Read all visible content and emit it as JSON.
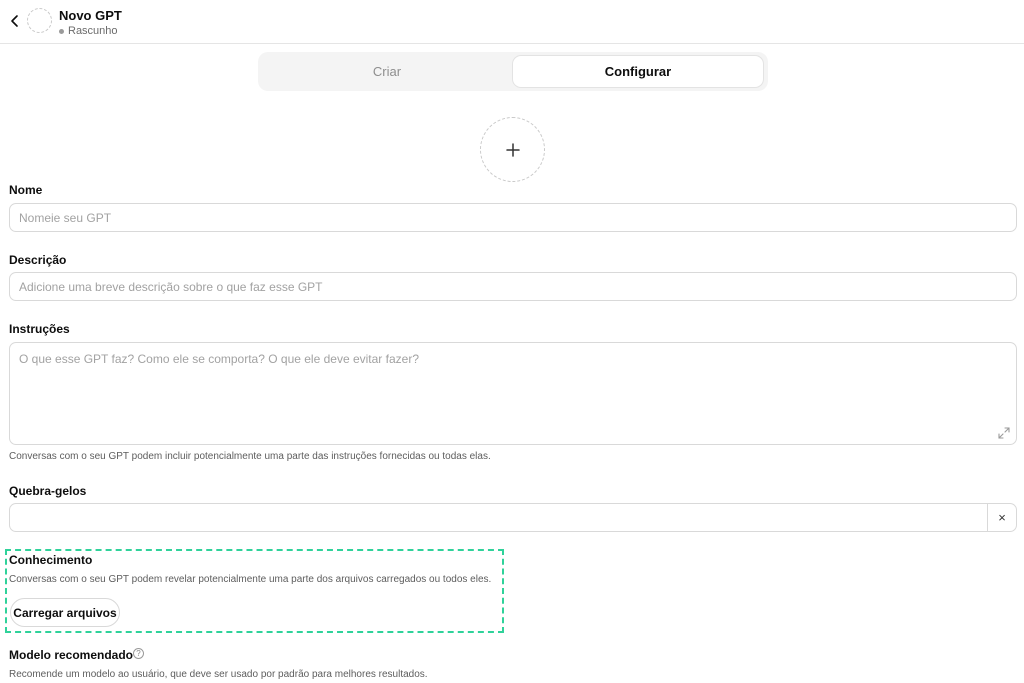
{
  "header": {
    "title": "Novo GPT",
    "status": "Rascunho"
  },
  "tabs": [
    {
      "label": "Criar",
      "active": false
    },
    {
      "label": "Configurar",
      "active": true
    }
  ],
  "avatar": {
    "icon": "plus-icon"
  },
  "fields": {
    "name": {
      "label": "Nome",
      "placeholder": "Nomeie seu GPT",
      "value": ""
    },
    "description": {
      "label": "Descrição",
      "placeholder": "Adicione uma breve descrição sobre o que faz esse GPT",
      "value": ""
    },
    "instructions": {
      "label": "Instruções",
      "placeholder": "O que esse GPT faz? Como ele se comporta? O que ele deve evitar fazer?",
      "value": "",
      "help": "Conversas com o seu GPT podem incluir potencialmente uma parte das instruções fornecidas ou todas elas."
    },
    "conversation_starters": {
      "label": "Quebra-gelos",
      "value": "",
      "remove": "×"
    }
  },
  "knowledge": {
    "label": "Conhecimento",
    "help": "Conversas com o seu GPT podem revelar potencialmente uma parte dos arquivos carregados ou todos eles.",
    "upload_label": "Carregar arquivos",
    "highlight_color": "#2fd29a"
  },
  "recommended_model": {
    "label": "Modelo recomendado",
    "info": "?",
    "help": "Recomende um modelo ao usuário, que deve ser usado por padrão para melhores resultados."
  }
}
